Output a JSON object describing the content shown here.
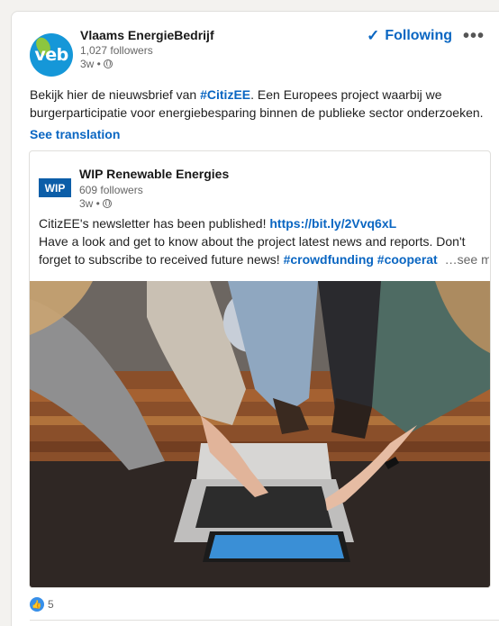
{
  "post": {
    "author": {
      "name": "Vlaams EnergieBedrijf",
      "logo_text": "veb",
      "followers": "1,027 followers",
      "time": "3w •"
    },
    "follow_button": {
      "icon": "✓",
      "label": "Following"
    },
    "more_button": {
      "label": "•••"
    },
    "text": {
      "part1": "Bekijk hier de nieuwsbrief van ",
      "hashtag": "#CitizEE",
      "part2": ". Een Europees project waarbij we burgerparticipatie voor energiebesparing binnen de publieke sector onderzoeken."
    },
    "see_translation": "See translation",
    "reactions": {
      "count": "5"
    }
  },
  "shared": {
    "author": {
      "name": "WIP Renewable Energies",
      "logo_text": "WIP",
      "followers": "609 followers",
      "time": "3w •"
    },
    "line1_text": "CitizEE's newsletter has been published! ",
    "line1_link": "https://bit.ly/2Vvq6xL",
    "line2": "Have a look and get to know about the project latest news and reports. Don't",
    "line3_text": "forget to subscribe to received future news! ",
    "line3_tags": "#crowdfunding #cooperat",
    "see_more": "…see more"
  },
  "colors": {
    "accent": "#0a66c2",
    "veb_logo": "#1597d8",
    "wip_logo": "#0c5ea8",
    "like": "#378fe9"
  }
}
